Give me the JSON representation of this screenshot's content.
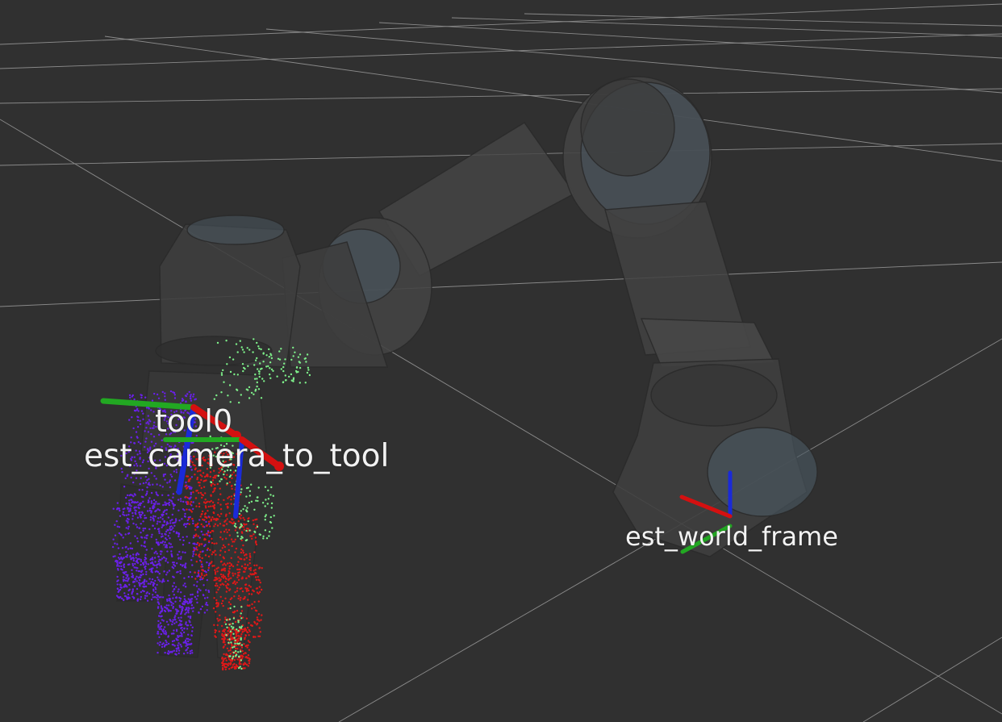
{
  "viewer": {
    "background_color": "#303030",
    "grid_color": "#a0a0a0",
    "robot_body_color": "#3e3e3e",
    "robot_joint_color": "#4a5a64",
    "axis_colors": {
      "x": "#d41010",
      "y": "#22a822",
      "z": "#1a2ad8"
    },
    "point_cloud_colors": [
      "#6a20e8",
      "#e01818",
      "#7ef08a"
    ]
  },
  "frames": [
    {
      "id": "tool0",
      "label": "tool0"
    },
    {
      "id": "est_camera_to_tool",
      "label": "est_camera_to_tool"
    },
    {
      "id": "est_world_frame",
      "label": "est_world_frame"
    }
  ]
}
